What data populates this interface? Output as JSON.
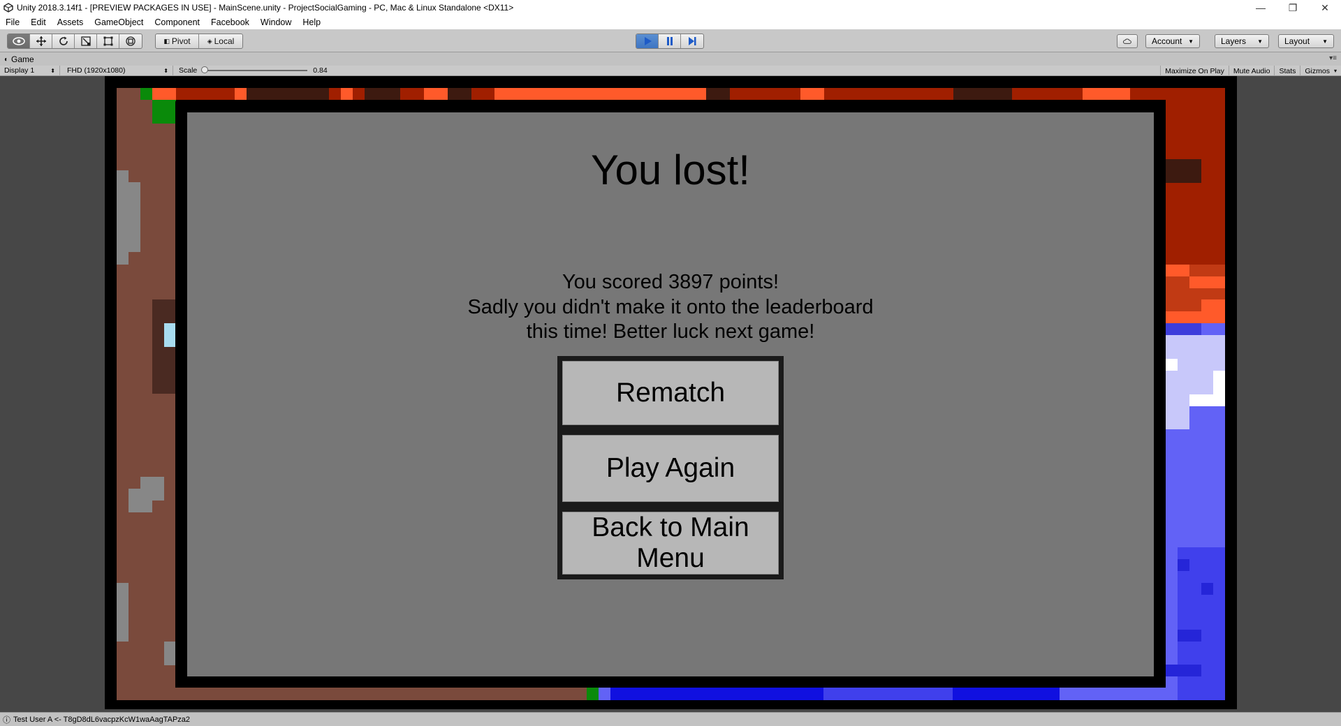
{
  "window": {
    "title": "Unity 2018.3.14f1 - [PREVIEW PACKAGES IN USE] - MainScene.unity - ProjectSocialGaming - PC, Mac & Linux Standalone <DX11>",
    "minimize_glyph": "—",
    "maximize_glyph": "❐",
    "close_glyph": "✕"
  },
  "menubar": {
    "items": [
      "File",
      "Edit",
      "Assets",
      "GameObject",
      "Component",
      "Facebook",
      "Window",
      "Help"
    ]
  },
  "toolbar": {
    "tools": [
      "view-tool-icon",
      "move-tool-icon",
      "rotate-tool-icon",
      "scale-tool-icon",
      "rect-tool-icon",
      "transform-tool-icon"
    ],
    "pivot_label": "Pivot",
    "local_label": "Local",
    "play_state": "playing",
    "account_label": "Account",
    "layers_label": "Layers",
    "layout_label": "Layout"
  },
  "game_window": {
    "tab_label": "Game",
    "display_label": "Display 1",
    "resolution_label": "FHD (1920x1080)",
    "scale_label": "Scale",
    "scale_value": "0.84",
    "maximize_label": "Maximize On Play",
    "mute_label": "Mute Audio",
    "stats_label": "Stats",
    "gizmos_label": "Gizmos"
  },
  "game_over": {
    "title": "You lost!",
    "score_line": "You scored 3897 points!",
    "leader_line1": "Sadly you didn't make it onto the leaderboard",
    "leader_line2": "this time! Better luck next game!",
    "buttons": [
      "Rematch",
      "Play Again",
      "Back to Main Menu"
    ]
  },
  "statusbar": {
    "message": "Test User A <- T8gD8dL6vacpzKcW1waAagTAPza2"
  },
  "colors": {
    "panel_bg": "#777777",
    "button_bg": "#b7b7b7",
    "brown_terrain": "#7a4a3c",
    "red_team": "#a01f00",
    "orange_accent": "#ff5a2a",
    "blue_team": "#6262f6",
    "dark_blue": "#1010e0",
    "play_blue": "#3e75c3"
  }
}
